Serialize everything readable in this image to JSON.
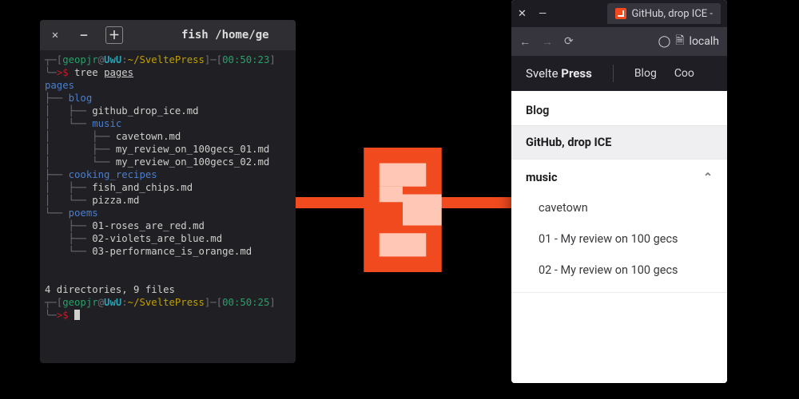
{
  "terminal": {
    "title": "fish /home/ge",
    "prompt1": {
      "user": "geopjr",
      "host": "UwU",
      "path": "~/SveltePress",
      "time": "00:50:23",
      "symbol": ">$",
      "cmd": "tree",
      "arg": "pages"
    },
    "tree_root": "pages",
    "tree_lines": [
      "├── blog",
      "│   ├── github_drop_ice.md",
      "│   └── music",
      "│       ├── cavetown.md",
      "│       ├── my_review_on_100gecs_01.md",
      "│       └── my_review_on_100gecs_02.md",
      "├── cooking_recipes",
      "│   ├── fish_and_chips.md",
      "│   └── pizza.md",
      "└── poems",
      "    ├── 01-roses_are_red.md",
      "    ├── 02-violets_are_blue.md",
      "    └── 03-performance_is_orange.md"
    ],
    "summary": "4 directories, 9 files",
    "prompt2": {
      "user": "geopjr",
      "host": "UwU",
      "path": "~/SveltePress",
      "time": "00:50:25",
      "symbol": ">$"
    }
  },
  "browser": {
    "tab_title": "GitHub, drop ICE -",
    "url_text": "localh",
    "brand_a": "Svelte",
    "brand_b": "Press",
    "nav": [
      "Blog",
      "Coo"
    ],
    "crumb": "Blog",
    "selected": "GitHub, drop ICE",
    "group": "music",
    "children": [
      "cavetown",
      "01 - My review on 100 gecs",
      "02 - My review on 100 gecs"
    ]
  }
}
